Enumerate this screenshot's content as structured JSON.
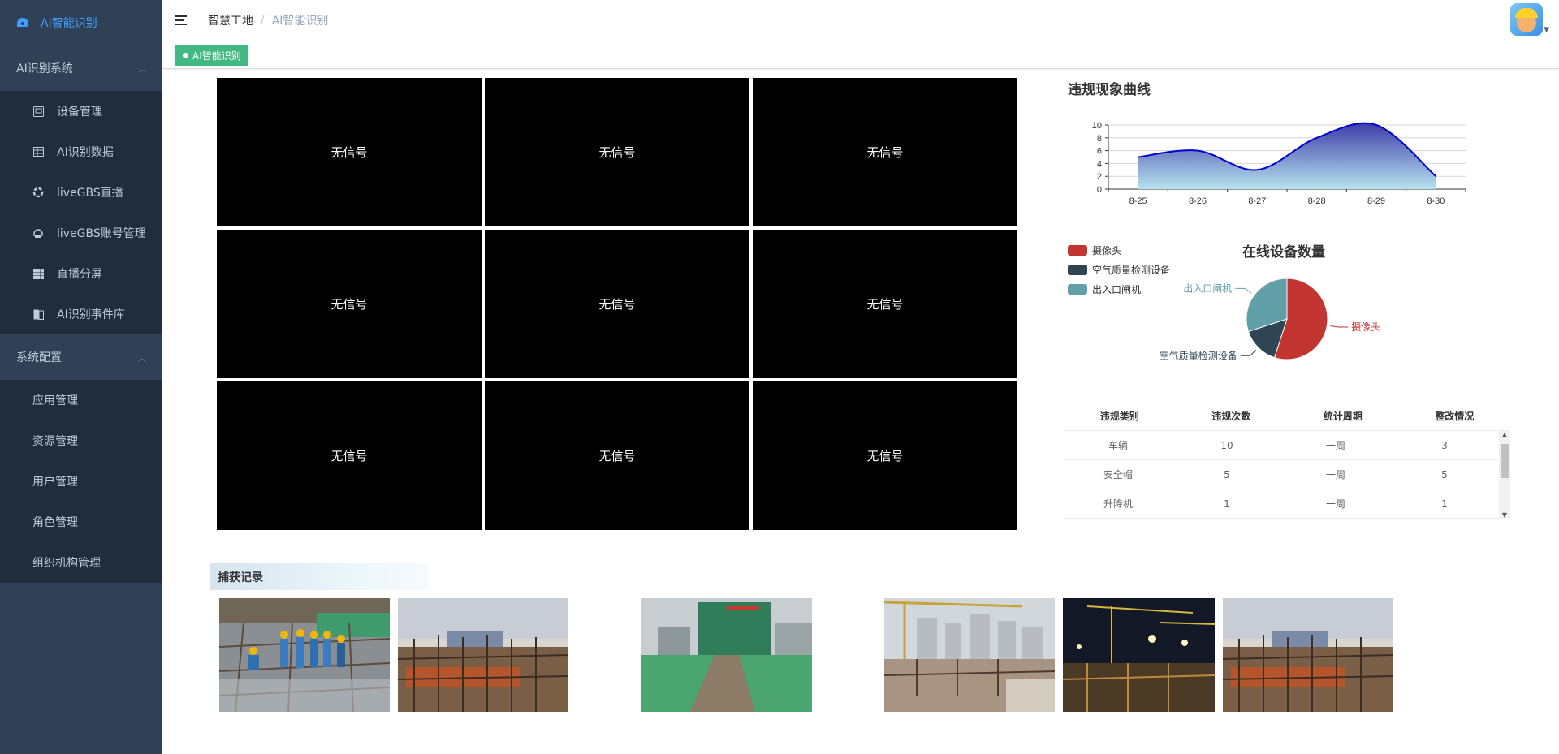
{
  "sidebar": {
    "logo_label": "AI智能识别",
    "groups": [
      {
        "label": "AI识别系统",
        "items": [
          {
            "label": "设备管理",
            "icon": "monitor-icon"
          },
          {
            "label": "AI识别数据",
            "icon": "table-icon"
          },
          {
            "label": "liveGBS直播",
            "icon": "live-icon"
          },
          {
            "label": "liveGBS账号管理",
            "icon": "account-icon"
          },
          {
            "label": "直播分屏",
            "icon": "grid-icon"
          },
          {
            "label": "AI识别事件库",
            "icon": "book-icon"
          }
        ]
      },
      {
        "label": "系统配置",
        "items": [
          {
            "label": "应用管理"
          },
          {
            "label": "资源管理"
          },
          {
            "label": "用户管理"
          },
          {
            "label": "角色管理"
          },
          {
            "label": "组织机构管理"
          }
        ]
      }
    ]
  },
  "navbar": {
    "breadcrumb": [
      "智慧工地",
      "AI智能识别"
    ]
  },
  "tags": [
    {
      "label": "AI智能识别",
      "active": true
    }
  ],
  "video_grid": {
    "cells": [
      "无信号",
      "无信号",
      "无信号",
      "无信号",
      "无信号",
      "无信号",
      "无信号",
      "无信号",
      "无信号"
    ]
  },
  "violation_chart": {
    "title": "违规现象曲线",
    "chart_data": {
      "type": "area",
      "categories": [
        "8-25",
        "8-26",
        "8-27",
        "8-28",
        "8-29",
        "8-30"
      ],
      "values": [
        5,
        6,
        3,
        8,
        10,
        2
      ],
      "ylim": [
        0,
        10
      ],
      "yticks": [
        0,
        2,
        4,
        6,
        8,
        10
      ],
      "colors": {
        "line": "#0000d0",
        "fill_top": "#3d3da8",
        "fill_bottom": "#b6e3ee"
      }
    }
  },
  "device_chart": {
    "title": "在线设备数量",
    "chart_data": {
      "type": "pie",
      "legend_position": "left",
      "slices": [
        {
          "name": "摄像头",
          "value": 55,
          "color": "#c23531"
        },
        {
          "name": "空气质量检测设备",
          "value": 15,
          "color": "#2f4554"
        },
        {
          "name": "出入口闸机",
          "value": 30,
          "color": "#61a0a8"
        }
      ]
    }
  },
  "violation_table": {
    "columns": [
      "违规类别",
      "违规次数",
      "统计周期",
      "整改情况"
    ],
    "rows": [
      [
        "车辆",
        "10",
        "一周",
        "3"
      ],
      [
        "安全帽",
        "5",
        "一周",
        "5"
      ],
      [
        "升降机",
        "1",
        "一周",
        "1"
      ]
    ]
  },
  "capture": {
    "title": "捕获记录",
    "photos": [
      {
        "name": "capture-photo-workers"
      },
      {
        "name": "capture-photo-rebar"
      },
      {
        "name": "capture-photo-green-net"
      },
      {
        "name": "capture-photo-crane"
      },
      {
        "name": "capture-photo-night"
      },
      {
        "name": "capture-photo-rebar-2"
      }
    ]
  }
}
